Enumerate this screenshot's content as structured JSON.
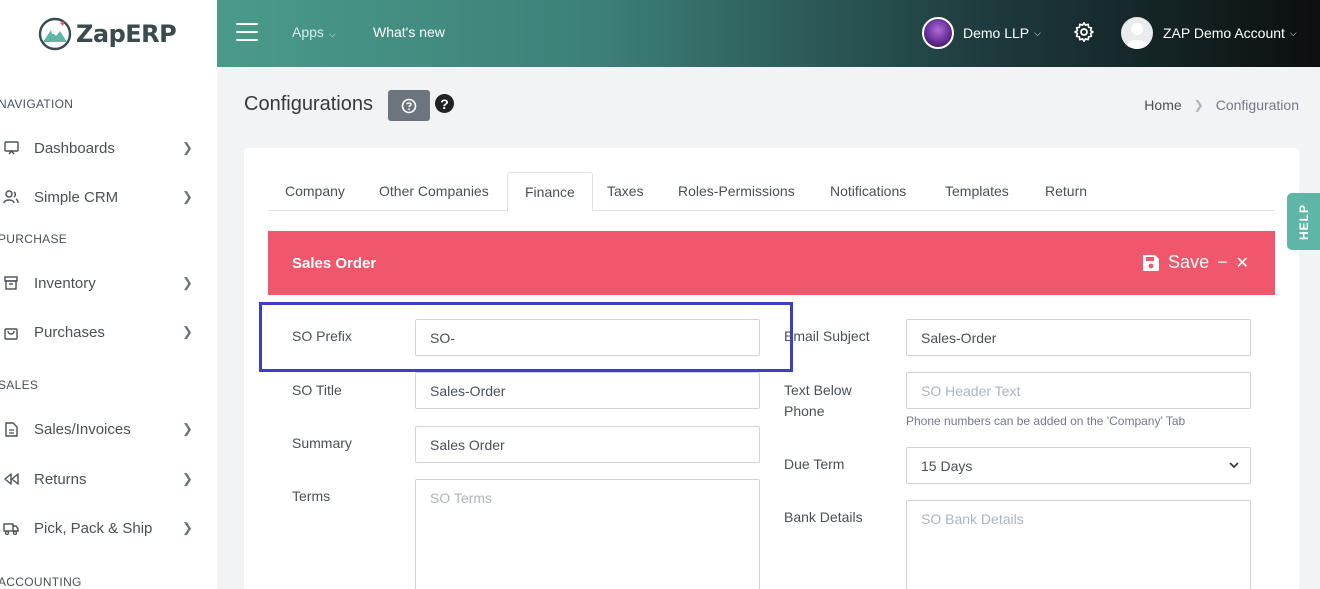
{
  "app": {
    "logo_text": "ZapERP"
  },
  "topbar": {
    "apps_label": "Apps",
    "whats_new_label": "What's new",
    "company_label": "Demo LLP",
    "account_label": "ZAP Demo Account"
  },
  "sidebar": {
    "sections": [
      "NAVIGATION",
      "PURCHASE",
      "SALES",
      "ACCOUNTING"
    ],
    "items": [
      {
        "label": "Dashboards",
        "icon": "monitor-icon"
      },
      {
        "label": "Simple CRM",
        "icon": "users-icon"
      },
      {
        "label": "Inventory",
        "icon": "box-icon"
      },
      {
        "label": "Purchases",
        "icon": "bag-icon"
      },
      {
        "label": "Sales/Invoices",
        "icon": "document-icon"
      },
      {
        "label": "Returns",
        "icon": "rewind-icon"
      },
      {
        "label": "Pick, Pack & Ship",
        "icon": "truck-icon"
      }
    ]
  },
  "page": {
    "title": "Configurations",
    "breadcrumb": {
      "home": "Home",
      "current": "Configuration"
    }
  },
  "tabs": [
    {
      "label": "Company",
      "active": false
    },
    {
      "label": "Other Companies",
      "active": false
    },
    {
      "label": "Finance",
      "active": true
    },
    {
      "label": "Taxes",
      "active": false
    },
    {
      "label": "Roles-Permissions",
      "active": false
    },
    {
      "label": "Notifications",
      "active": false
    },
    {
      "label": "Templates",
      "active": false
    },
    {
      "label": "Return",
      "active": false
    }
  ],
  "sales_order": {
    "title": "Sales Order",
    "save_label": "Save",
    "minimize_glyph": "−",
    "close_glyph": "✕",
    "accent_color": "#f0566c",
    "fields": {
      "so_prefix": {
        "label": "SO Prefix",
        "value": "SO-"
      },
      "so_title": {
        "label": "SO Title",
        "value": "Sales-Order"
      },
      "summary": {
        "label": "Summary",
        "value": "Sales Order"
      },
      "terms": {
        "label": "Terms",
        "placeholder": "SO Terms"
      },
      "email_subject": {
        "label": "Email Subject",
        "value": "Sales-Order"
      },
      "text_below_phone": {
        "label_line1": "Text Below",
        "label_line2": "Phone",
        "placeholder": "SO Header Text",
        "help": "Phone numbers can be added on the 'Company' Tab"
      },
      "due_term": {
        "label": "Due Term",
        "value": "15 Days"
      },
      "bank_details": {
        "label": "Bank Details",
        "placeholder": "SO Bank Details"
      }
    }
  },
  "help_tab": {
    "label": "HELP"
  }
}
